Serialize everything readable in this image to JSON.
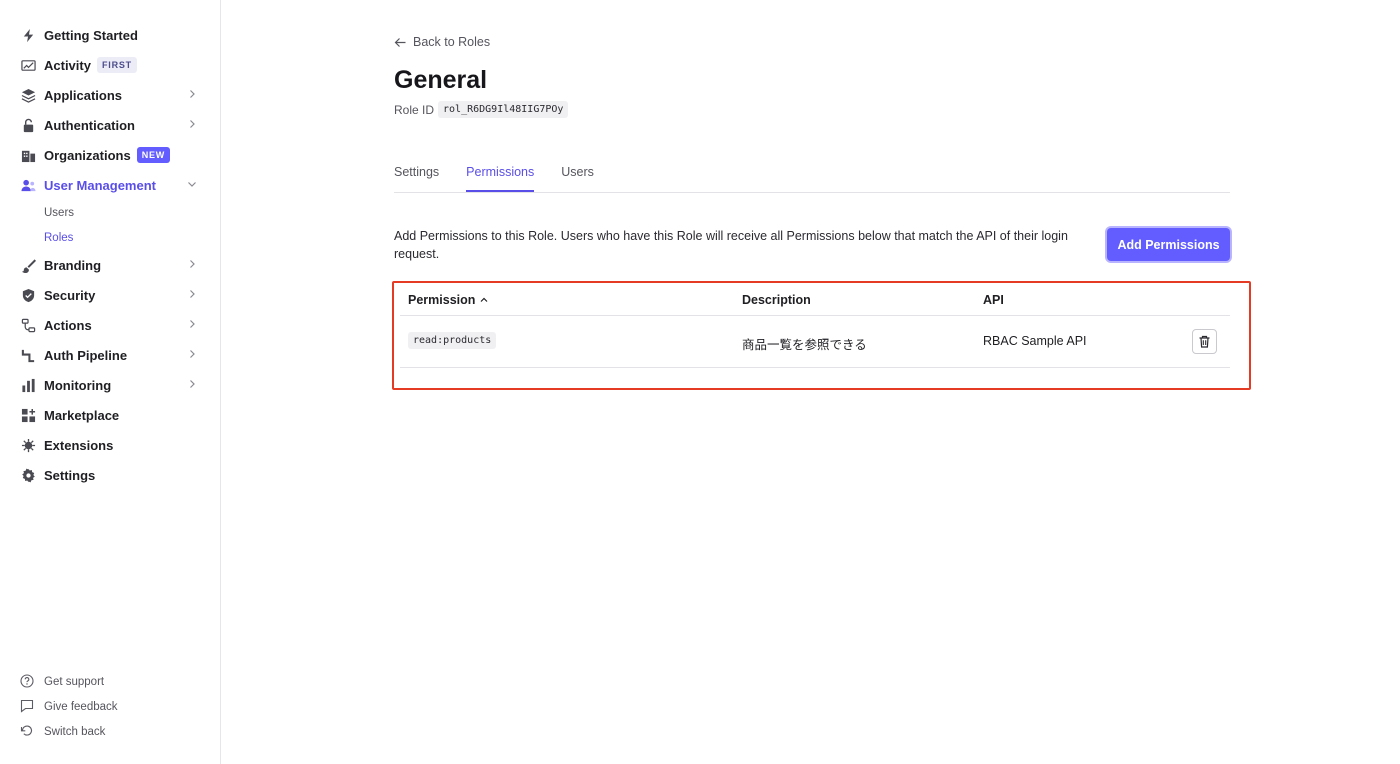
{
  "sidebar": {
    "items": [
      {
        "label": "Getting Started"
      },
      {
        "label": "Activity",
        "badge": "FIRST"
      },
      {
        "label": "Applications"
      },
      {
        "label": "Authentication"
      },
      {
        "label": "Organizations",
        "badge": "NEW"
      },
      {
        "label": "User Management"
      },
      {
        "label": "Branding"
      },
      {
        "label": "Security"
      },
      {
        "label": "Actions"
      },
      {
        "label": "Auth Pipeline"
      },
      {
        "label": "Monitoring"
      },
      {
        "label": "Marketplace"
      },
      {
        "label": "Extensions"
      },
      {
        "label": "Settings"
      }
    ],
    "sub_items": [
      {
        "label": "Users"
      },
      {
        "label": "Roles"
      }
    ],
    "footer": [
      {
        "label": "Get support"
      },
      {
        "label": "Give feedback"
      },
      {
        "label": "Switch back"
      }
    ]
  },
  "main": {
    "back_label": "Back to Roles",
    "title": "General",
    "role_id_label": "Role ID",
    "role_id": "rol_R6DG9Il48IIG7POy",
    "tabs": [
      {
        "label": "Settings"
      },
      {
        "label": "Permissions"
      },
      {
        "label": "Users"
      }
    ],
    "description": "Add Permissions to this Role. Users who have this Role will receive all Permissions below that match the API of their login request.",
    "add_button": "Add Permissions",
    "table": {
      "headers": {
        "permission": "Permission",
        "description": "Description",
        "api": "API"
      },
      "rows": [
        {
          "permission": "read:products",
          "description": "商品一覧を参照できる",
          "api": "RBAC Sample API"
        }
      ]
    }
  },
  "colors": {
    "accent": "#635dff",
    "highlight": "#e53a24"
  }
}
